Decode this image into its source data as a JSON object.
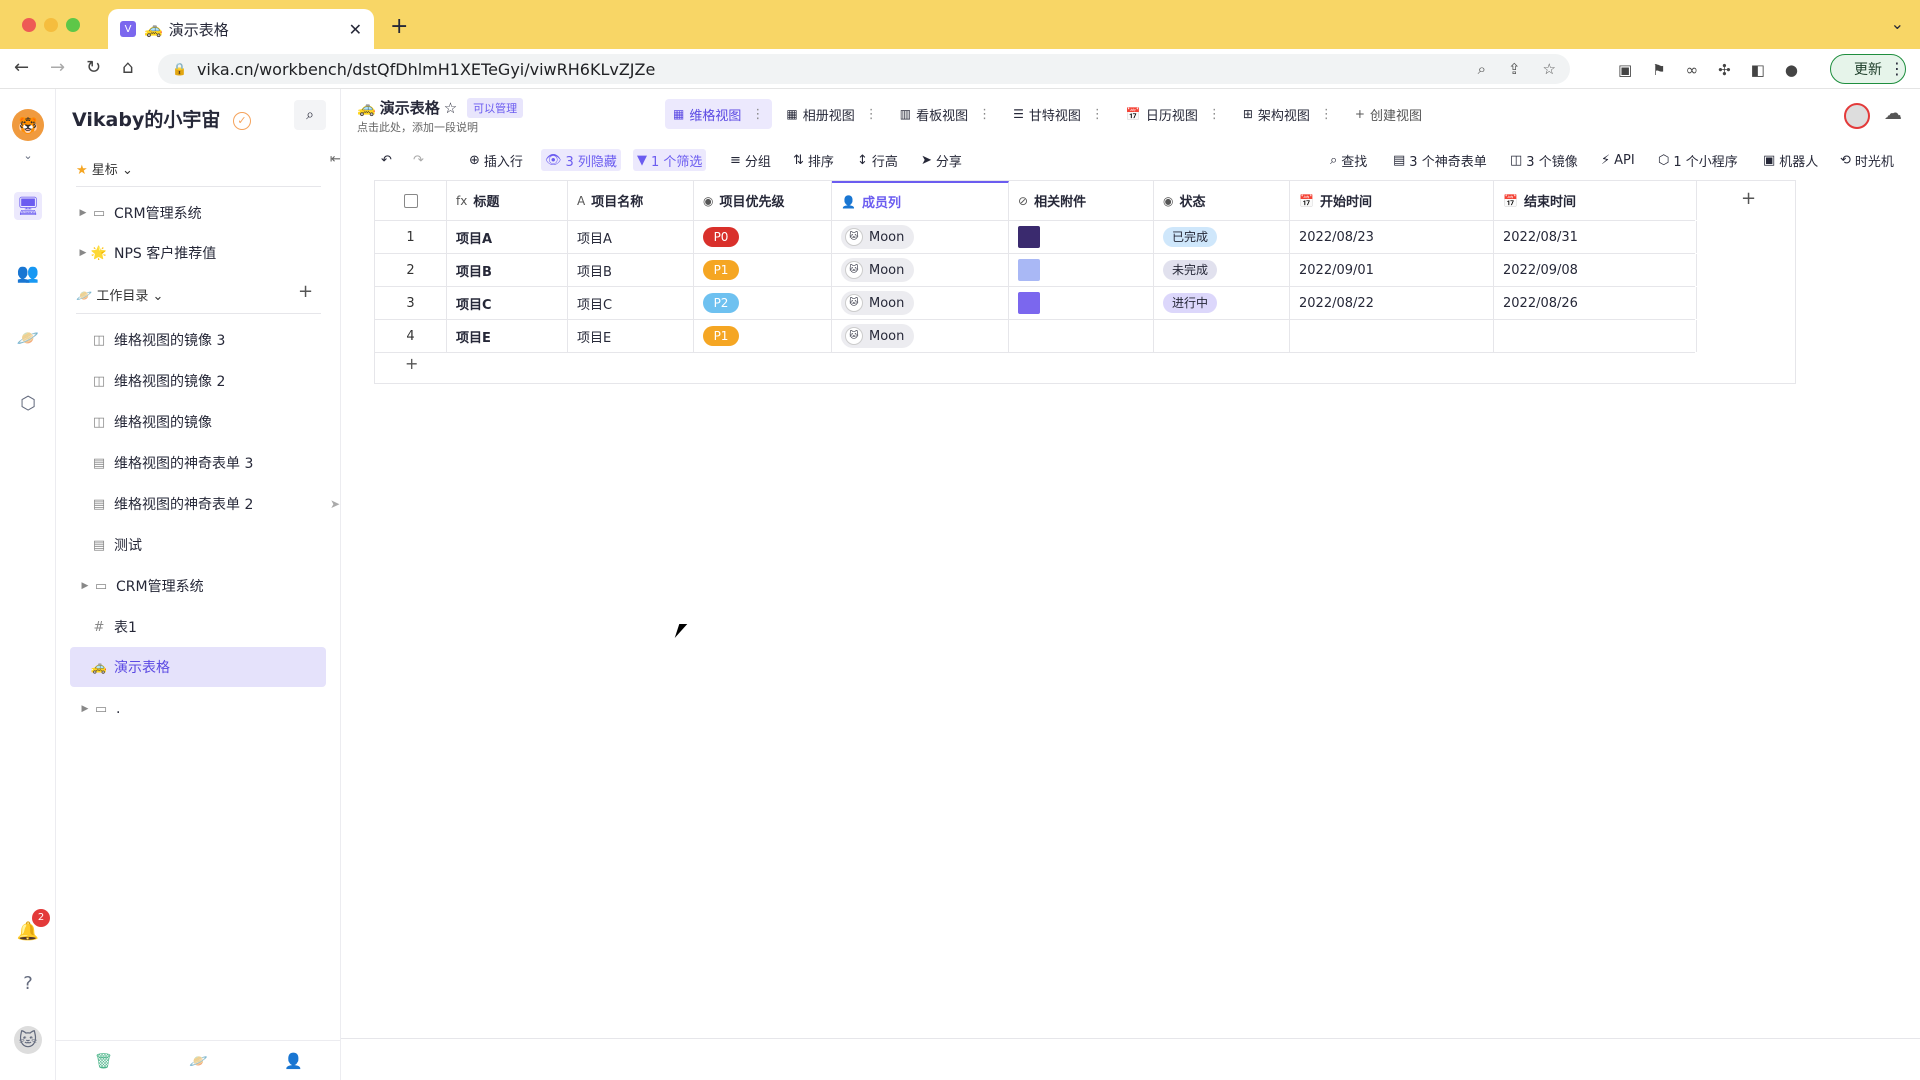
{
  "browser": {
    "tab_title": "演示表格",
    "url": "vika.cn/workbench/dstQfDhlmH1XETeGyi/viwRH6KLvZJZe",
    "update_label": "更新"
  },
  "sidebar": {
    "space_name": "Vikaby的小宇宙",
    "starred_label": "星标",
    "starred_items": [
      {
        "label": "CRM管理系统"
      },
      {
        "label": "NPS 客户推荐值"
      }
    ],
    "catalog_label": "工作目录",
    "catalog_items": [
      {
        "label": "维格视图的镜像 3"
      },
      {
        "label": "维格视图的镜像 2"
      },
      {
        "label": "维格视图的镜像"
      },
      {
        "label": "维格视图的神奇表单 3"
      },
      {
        "label": "维格视图的神奇表单 2"
      },
      {
        "label": "测试"
      },
      {
        "label": "CRM管理系统"
      },
      {
        "label": "表1"
      },
      {
        "label": "演示表格"
      },
      {
        "label": "."
      }
    ]
  },
  "notifications": {
    "count": "2"
  },
  "header": {
    "title": "演示表格",
    "permission": "可以管理",
    "description": "点击此处，添加一段说明",
    "views": [
      {
        "label": "维格视图"
      },
      {
        "label": "相册视图"
      },
      {
        "label": "看板视图"
      },
      {
        "label": "甘特视图"
      },
      {
        "label": "日历视图"
      },
      {
        "label": "架构视图"
      }
    ],
    "create_view": "创建视图"
  },
  "toolbar": {
    "insert_row": "插入行",
    "hidden_cols": "3 列隐藏",
    "filter": "1 个筛选",
    "group": "分组",
    "sort": "排序",
    "row_height": "行高",
    "share": "分享",
    "search": "查找",
    "forms": "3 个神奇表单",
    "mirrors": "3 个镜像",
    "api": "API",
    "widgets": "1 个小程序",
    "robots": "机器人",
    "timemachine": "时光机"
  },
  "grid": {
    "columns": [
      "标题",
      "项目名称",
      "项目优先级",
      "成员列",
      "相关附件",
      "状态",
      "开始时间",
      "结束时间"
    ],
    "rows": [
      {
        "index": "1",
        "title": "项目A",
        "name": "项目A",
        "priority": "P0",
        "priority_color": "#d9302b",
        "member": "Moon",
        "attach_color": "#3a2a6e",
        "status": "已完成",
        "status_color": "#cfe7fb",
        "start": "2022/08/23",
        "end": "2022/08/31"
      },
      {
        "index": "2",
        "title": "项目B",
        "name": "项目B",
        "priority": "P1",
        "priority_color": "#f5a623",
        "member": "Moon",
        "attach_color": "#a9b8f5",
        "status": "未完成",
        "status_color": "#e1e1ee",
        "start": "2022/09/01",
        "end": "2022/09/08"
      },
      {
        "index": "3",
        "title": "项目C",
        "name": "项目C",
        "priority": "P2",
        "priority_color": "#6ec1f0",
        "member": "Moon",
        "attach_color": "#7b67ee",
        "status": "进行中",
        "status_color": "#dcd7fb",
        "start": "2022/08/22",
        "end": "2022/08/26"
      },
      {
        "index": "4",
        "title": "项目E",
        "name": "项目E",
        "priority": "P1",
        "priority_color": "#f5a623",
        "member": "Moon",
        "attach_color": "",
        "status": "",
        "status_color": "",
        "start": "",
        "end": ""
      }
    ]
  }
}
